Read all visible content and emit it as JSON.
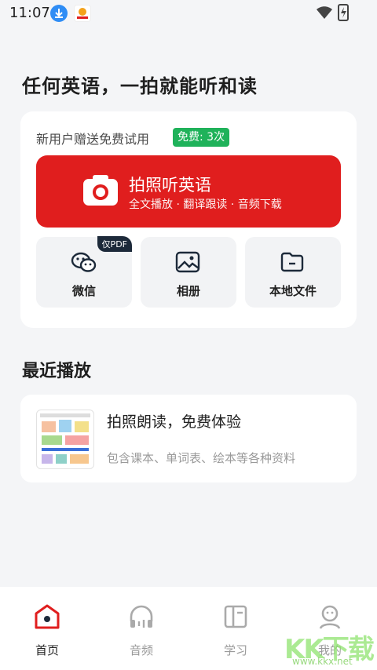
{
  "status": {
    "time": "11:07"
  },
  "page": {
    "title": "任何英语，一拍就能听和读"
  },
  "trial": {
    "text": "新用户赠送免费试用",
    "badge": "免费: 3次"
  },
  "photo_button": {
    "title": "拍照听英语",
    "subtitle": "全文播放 · 翻译跟读 · 音频下载"
  },
  "sources": [
    {
      "label": "微信",
      "tag": "仅PDF",
      "icon": "wechat-icon"
    },
    {
      "label": "相册",
      "icon": "image-icon"
    },
    {
      "label": "本地文件",
      "icon": "folder-icon"
    }
  ],
  "recent": {
    "section_title": "最近播放",
    "item": {
      "title": "拍照朗读，免费体验",
      "subtitle": "包含课本、单词表、绘本等各种资料"
    }
  },
  "tabs": [
    {
      "label": "首页",
      "icon": "home-icon",
      "active": true
    },
    {
      "label": "音频",
      "icon": "headphones-icon"
    },
    {
      "label": "学习",
      "icon": "book-icon"
    },
    {
      "label": "我的",
      "icon": "profile-icon"
    }
  ],
  "watermark": {
    "text": "KK下载",
    "url": "www.kkx.net"
  },
  "colors": {
    "accent": "#e01e1e",
    "badge": "#1fb25a",
    "background": "#f4f5f7"
  }
}
